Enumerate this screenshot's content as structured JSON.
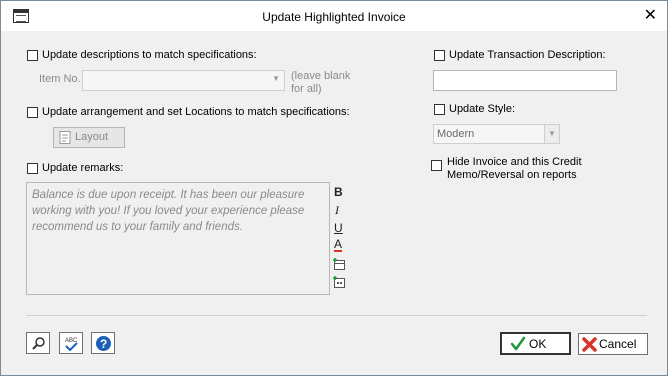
{
  "window": {
    "title": "Update Highlighted Invoice",
    "close_glyph": "✕"
  },
  "left": {
    "update_descriptions_label": "Update descriptions to match specifications:",
    "item_no_label": "Item No.",
    "item_no_value": "",
    "item_no_hint_line1": "(leave blank",
    "item_no_hint_line2": "for all)",
    "update_arrangement_label": "Update arrangement and set Locations to match specifications:",
    "layout_button_label": "Layout",
    "update_remarks_label": "Update remarks:",
    "remarks_text": "Balance is due upon receipt.  It has been our pleasure\nworking with you!  If you loved your experience please\nrecommend us to your family and friends."
  },
  "format_toolbar": {
    "bold": "B",
    "italic": "I",
    "underline": "U",
    "font_color": "A"
  },
  "right": {
    "update_transaction_label": "Update Transaction Description:",
    "transaction_value": "",
    "update_style_label": "Update Style:",
    "style_value": "Modern",
    "hide_invoice_line1": "Hide Invoice and this Credit",
    "hide_invoice_line2": "Memo/Reversal on reports"
  },
  "footer": {
    "ok_label": "OK",
    "cancel_label": "Cancel"
  },
  "colors": {
    "accent_check": "#1a9a3c",
    "cancel_red": "#d9342b",
    "help_blue": "#1c5fb8"
  },
  "icons": [
    "app-icon",
    "close-icon",
    "search-icon",
    "spellcheck-icon",
    "help-icon",
    "insert-field-icon",
    "insert-date-icon",
    "checkmark-icon",
    "x-icon"
  ]
}
